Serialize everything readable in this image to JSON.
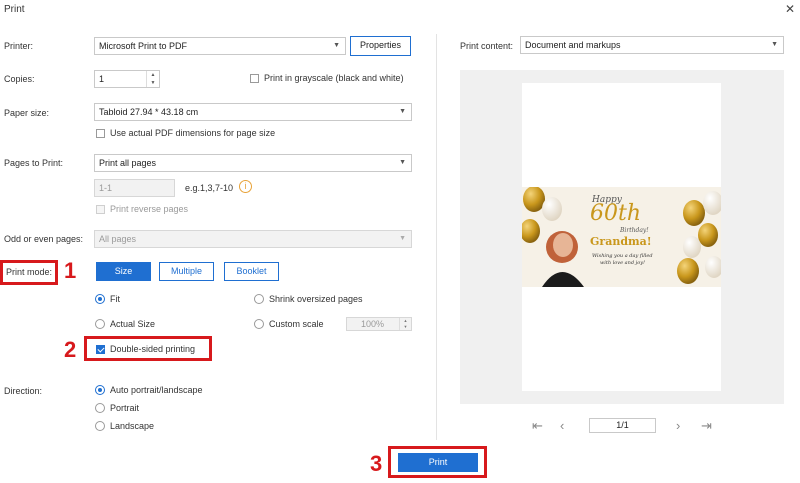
{
  "window": {
    "title": "Print",
    "close_glyph": "✕"
  },
  "printer": {
    "label": "Printer:",
    "value": "Microsoft Print to PDF",
    "properties_label": "Properties"
  },
  "copies": {
    "label": "Copies:",
    "value": "1"
  },
  "grayscale": {
    "label": "Print in grayscale (black and white)",
    "checked": false
  },
  "paper_size": {
    "label": "Paper size:",
    "value": "Tabloid 27.94 * 43.18 cm"
  },
  "actual_pdf_dims": {
    "label": "Use actual PDF dimensions for page size",
    "checked": false
  },
  "pages_to_print": {
    "label": "Pages to Print:",
    "value": "Print all pages",
    "range_placeholder": "1-1",
    "range_hint": "e.g.1,3,7-10",
    "info_glyph": "i",
    "reverse_label": "Print reverse pages"
  },
  "odd_even": {
    "label": "Odd or even pages:",
    "value": "All pages"
  },
  "print_mode": {
    "label": "Print mode:",
    "tabs": [
      "Size",
      "Multiple",
      "Booklet"
    ],
    "selected_tab": "Size",
    "fit_label": "Fit",
    "actual_size_label": "Actual Size",
    "shrink_label": "Shrink oversized pages",
    "custom_scale_label": "Custom scale",
    "scale_value": "100%",
    "double_sided_label": "Double-sided printing",
    "double_sided_checked": true
  },
  "direction": {
    "label": "Direction:",
    "options": [
      "Auto portrait/landscape",
      "Portrait",
      "Landscape"
    ],
    "selected": "Auto portrait/landscape"
  },
  "print_content": {
    "label": "Print content:",
    "value": "Document and markups"
  },
  "preview": {
    "page_indicator": "1/1",
    "banner": {
      "line1": "Happy",
      "line2": "60th",
      "line3": "Birthday!",
      "line4": "Grandma!",
      "line5": "Wishing you a day filled",
      "line6": "with love and joy!"
    }
  },
  "print_button_label": "Print",
  "annotations": [
    "1",
    "2",
    "3"
  ],
  "colors": {
    "accent": "#1f6fd1",
    "annotation": "#d7191c",
    "gold": "#c9971c"
  }
}
